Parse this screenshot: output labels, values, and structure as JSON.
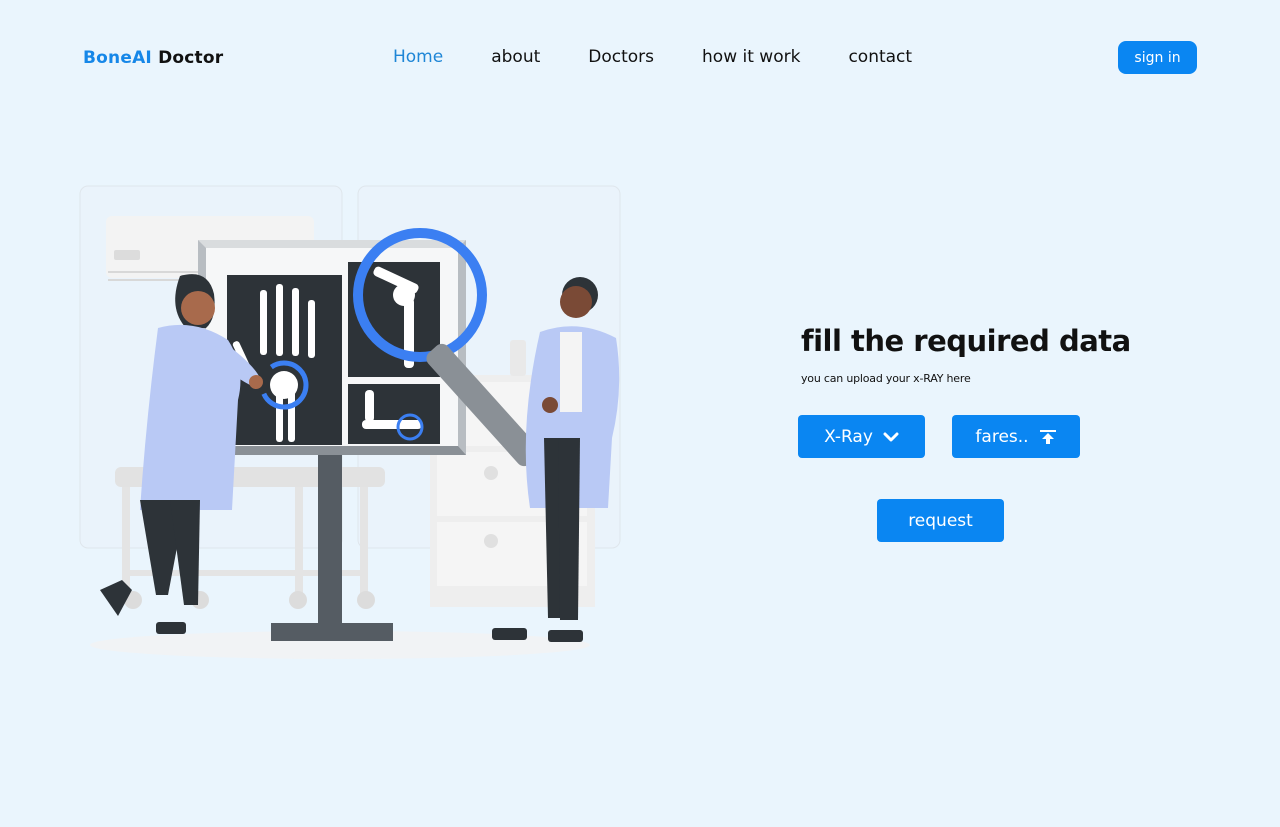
{
  "header": {
    "logo_brand": "BoneAI",
    "logo_rest": "Doctor",
    "nav": [
      {
        "label": "Home",
        "active": true
      },
      {
        "label": "about"
      },
      {
        "label": "Doctors"
      },
      {
        "label": "how it work"
      },
      {
        "label": "contact"
      }
    ],
    "signin_label": "sign in"
  },
  "main": {
    "headline": "fill the required data",
    "subline": "you can upload your x-RAY here",
    "type_select": {
      "label": "X-Ray",
      "icon": "chevron-down-icon"
    },
    "file_upload": {
      "label": "fares..",
      "icon": "upload-icon"
    },
    "request_label": "request"
  },
  "colors": {
    "background": "#eaf5fd",
    "accent": "#0a86f2",
    "brand": "#1687e8"
  }
}
